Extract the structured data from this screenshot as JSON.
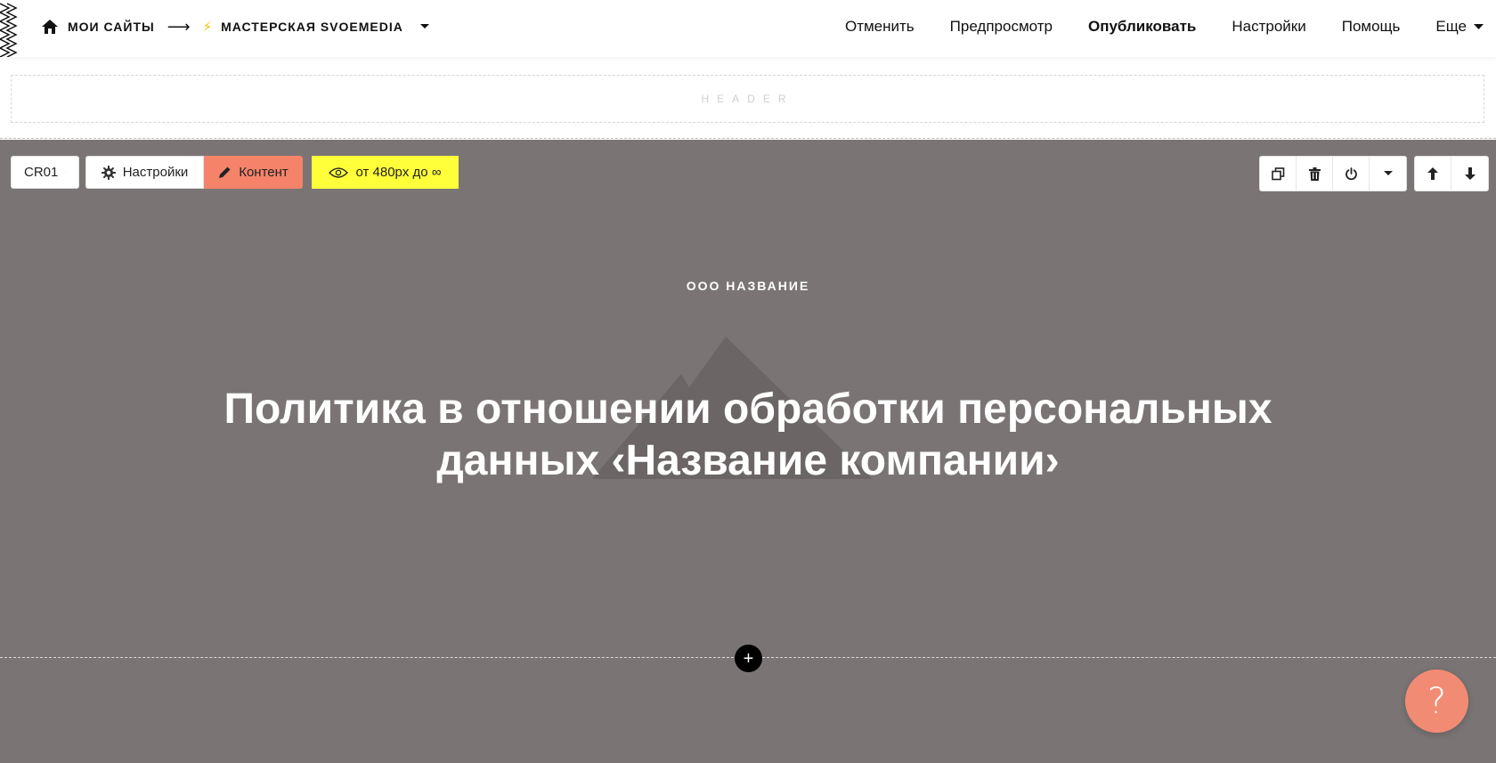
{
  "breadcrumbs": {
    "home_label": "МОИ САЙТЫ",
    "arrow": "⟶",
    "site_name": "МАСТЕРСКАЯ SVOEMEDIA"
  },
  "topnav": {
    "cancel": "Отменить",
    "preview": "Предпросмотр",
    "publish": "Опубликовать",
    "settings": "Настройки",
    "help": "Помощь",
    "more": "Еще"
  },
  "header_placeholder": "HEADER",
  "block_toolbar": {
    "code": "CR01",
    "settings": "Настройки",
    "content": "Контент",
    "visibility": "от 480px до ∞"
  },
  "block": {
    "company": "ООО НАЗВАНИЕ",
    "title_line1": "Политика в отношении обработки персональных",
    "title_line2": "данных ‹Название компании›",
    "add_symbol": "+"
  },
  "help_button": "?",
  "colors": {
    "block_bg": "#7a7574",
    "content_accent": "#f4836a",
    "visibility_accent": "#ffff3a",
    "help_accent": "#f28b74",
    "bolt": "#f2c200"
  }
}
